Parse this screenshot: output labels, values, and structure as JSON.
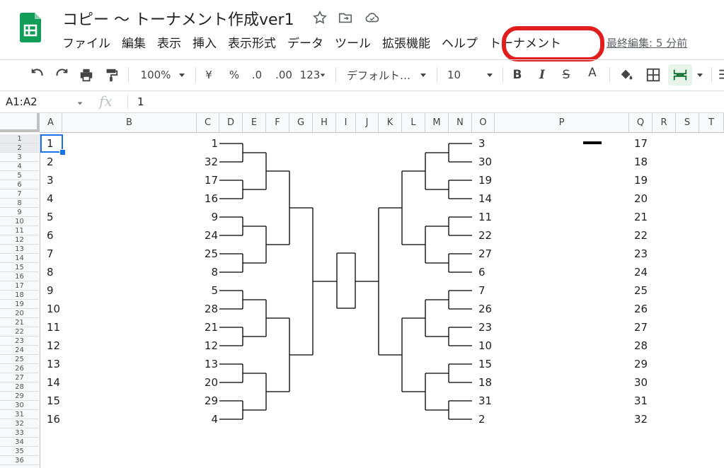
{
  "app": {
    "title": "コピー 〜 トーナメント作成ver1",
    "last_edit": "最終編集: 5 分前"
  },
  "menu": [
    "ファイル",
    "編集",
    "表示",
    "挿入",
    "表示形式",
    "データ",
    "ツール",
    "拡張機能",
    "ヘルプ",
    "トーナメント"
  ],
  "toolbar": {
    "zoom": "100%",
    "currency": "¥",
    "percent": "%",
    "dec_less": ".0",
    "dec_more": ".00",
    "more_formats": "123",
    "font": "デフォルト…",
    "font_size": "10",
    "bold": "B",
    "italic": "I",
    "strike": "S",
    "text_color": "A"
  },
  "formula_bar": {
    "name_box": "A1:A2",
    "fx": "fx",
    "value": "1"
  },
  "columns": [
    "A",
    "B",
    "C",
    "D",
    "E",
    "F",
    "G",
    "H",
    "I",
    "J",
    "K",
    "L",
    "M",
    "N",
    "O",
    "P",
    "Q",
    "R",
    "S",
    "T"
  ],
  "rows": [
    "1",
    "2",
    "3",
    "4",
    "5",
    "6",
    "7",
    "8",
    "9",
    "10",
    "11",
    "12",
    "13",
    "14",
    "15",
    "16",
    "17",
    "18",
    "19",
    "20",
    "21",
    "22",
    "23",
    "24",
    "25",
    "26",
    "27",
    "28",
    "29",
    "30",
    "31",
    "32",
    "33",
    "34",
    "35",
    "36"
  ],
  "cells": {
    "col_a": [
      "1",
      "2",
      "3",
      "4",
      "5",
      "6",
      "7",
      "8",
      "9",
      "10",
      "11",
      "12",
      "13",
      "14",
      "15",
      "16"
    ],
    "col_c": [
      "1",
      "32",
      "17",
      "16",
      "9",
      "24",
      "25",
      "8",
      "5",
      "28",
      "21",
      "12",
      "13",
      "20",
      "29",
      "4"
    ],
    "col_o": [
      "3",
      "30",
      "19",
      "14",
      "11",
      "22",
      "27",
      "6",
      "7",
      "26",
      "23",
      "10",
      "15",
      "18",
      "31",
      "2"
    ],
    "col_q": [
      "17",
      "18",
      "19",
      "20",
      "21",
      "22",
      "23",
      "24",
      "25",
      "26",
      "27",
      "28",
      "29",
      "30",
      "31",
      "32"
    ]
  },
  "colors": {
    "highlight": "#e01e1e",
    "selection": "#1a73e8",
    "sheets_green": "#0f9d58"
  }
}
